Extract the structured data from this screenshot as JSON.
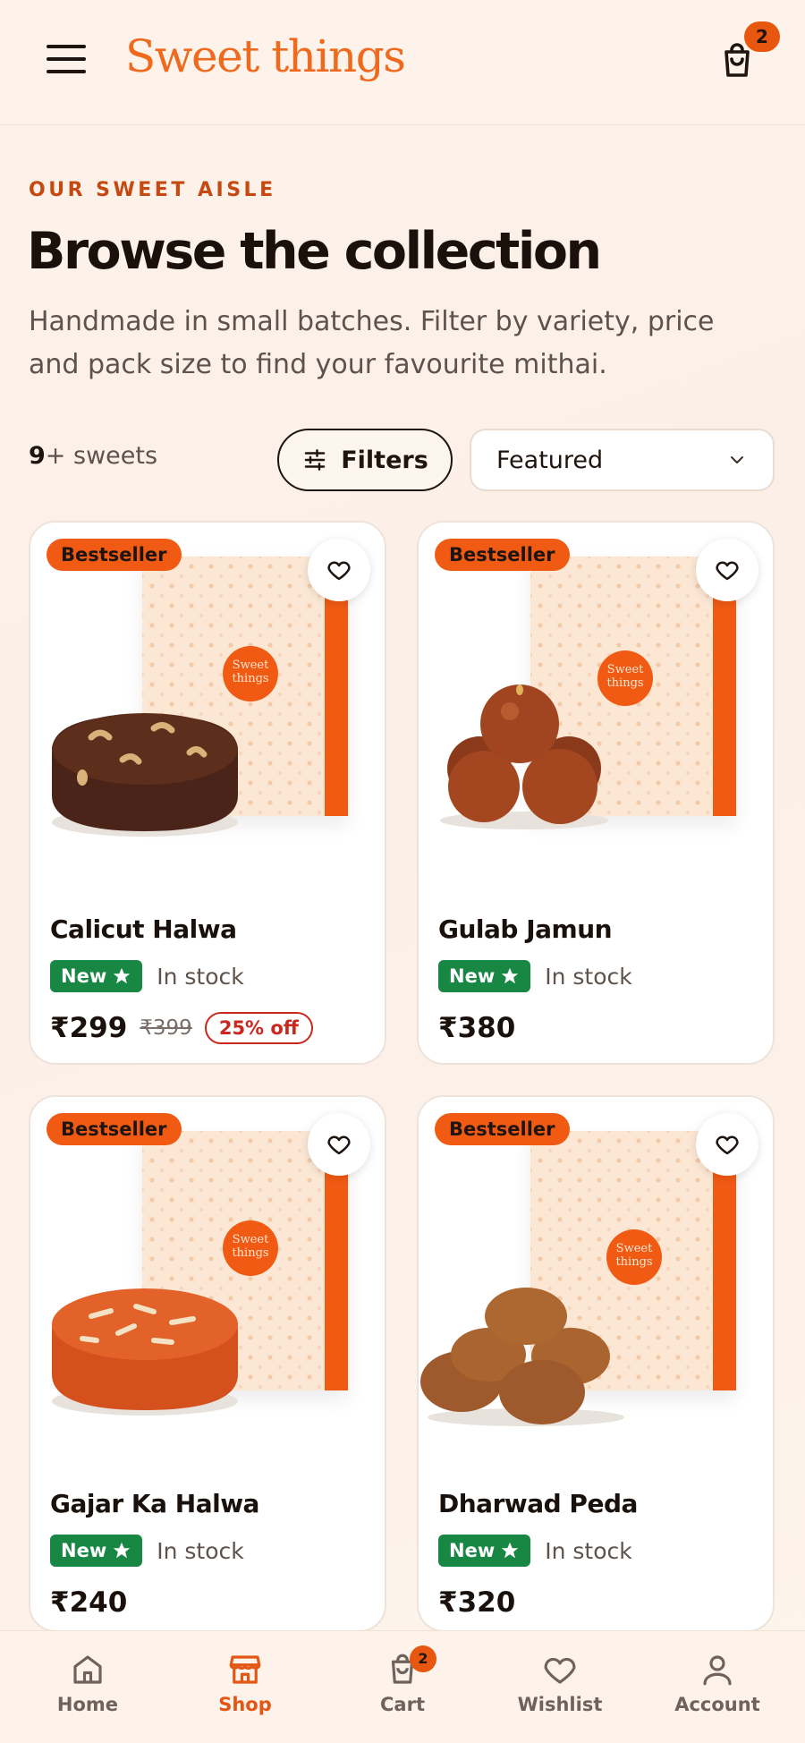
{
  "header": {
    "logo": "Sweet things",
    "cart_count": "2"
  },
  "intro": {
    "eyebrow": "OUR SWEET AISLE",
    "title": "Browse the collection",
    "subtitle": "Handmade in small batches. Filter by variety, price and pack size to find your favourite mithai."
  },
  "toolbar": {
    "count_number": "9",
    "count_suffix": "+ sweets",
    "filters_label": "Filters",
    "sort_value": "Featured"
  },
  "products": [
    {
      "name": "Calicut Halwa",
      "tag": "Bestseller",
      "badge": "New",
      "stock": "In stock",
      "price": "₹299",
      "old_price": "₹399",
      "discount": "25% off",
      "seal": "Sweet things"
    },
    {
      "name": "Gulab Jamun",
      "tag": "Bestseller",
      "badge": "New",
      "stock": "In stock",
      "price": "₹380",
      "seal": "Sweet things"
    },
    {
      "name": "Gajar Ka Halwa",
      "tag": "Bestseller",
      "badge": "New",
      "stock": "In stock",
      "price": "₹240",
      "seal": "Sweet things"
    },
    {
      "name": "Dharwad Peda",
      "tag": "Bestseller",
      "badge": "New",
      "stock": "In stock",
      "price": "₹320",
      "seal": "Sweet things"
    }
  ],
  "nav": {
    "home": "Home",
    "shop": "Shop",
    "cart": "Cart",
    "cart_count": "2",
    "wishlist": "Wishlist",
    "account": "Account"
  },
  "colors": {
    "accent": "#f05a12",
    "logo": "#ef6a1f",
    "new_badge": "#188743",
    "discount": "#c8281e",
    "background": "#fdf3ea"
  },
  "icons": [
    "menu-icon",
    "shopping-bag-icon",
    "sliders-icon",
    "chevron-down-icon",
    "heart-icon",
    "star-icon",
    "home-icon",
    "store-icon",
    "cart-icon",
    "heart-outline-icon",
    "user-icon"
  ]
}
